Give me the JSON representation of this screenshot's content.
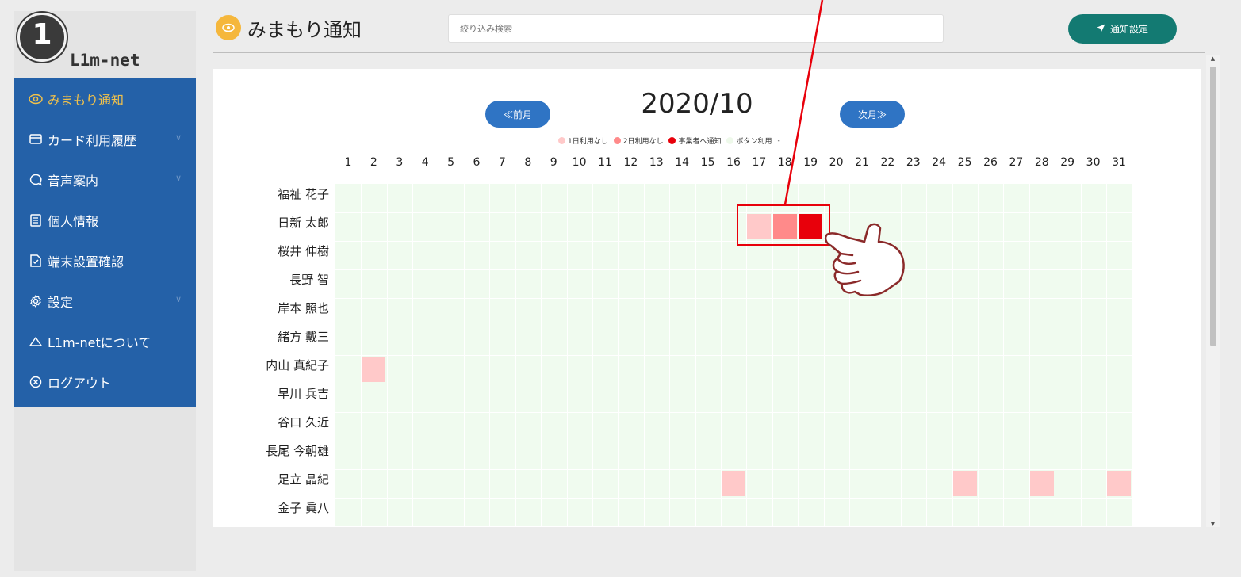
{
  "brand": {
    "logo_text": "L1m-net"
  },
  "sidebar": {
    "items": [
      {
        "label": "みまもり通知",
        "icon": "eye-icon"
      },
      {
        "label": "カード利用履歴",
        "icon": "card-icon"
      },
      {
        "label": "音声案内",
        "icon": "speech-bubble-icon"
      },
      {
        "label": "個人情報",
        "icon": "document-icon"
      },
      {
        "label": "端末設置確認",
        "icon": "check-document-icon"
      },
      {
        "label": "設定",
        "icon": "gear-icon"
      },
      {
        "label": "L1m-netについて",
        "icon": "cloud-icon"
      },
      {
        "label": "ログアウト",
        "icon": "close-circle-icon"
      }
    ],
    "active_index": 0
  },
  "header": {
    "title": "みまもり通知",
    "search_placeholder": "絞り込み検索",
    "notify_button": "通知設定"
  },
  "calendar": {
    "month": "2020/10",
    "prev_label": "≪前月",
    "next_label": "次月≫",
    "legend": [
      {
        "label": "1日利用なし",
        "color": "#ffc9c9"
      },
      {
        "label": "2日利用なし",
        "color": "#ff8a8a"
      },
      {
        "label": "事業者へ通知",
        "color": "#e8000b"
      },
      {
        "label": "ボタン利用",
        "color": "#eef9ea"
      },
      {
        "label": "-",
        "color": ""
      }
    ],
    "days": [
      "1",
      "2",
      "3",
      "4",
      "5",
      "6",
      "7",
      "8",
      "9",
      "10",
      "11",
      "12",
      "13",
      "14",
      "15",
      "16",
      "17",
      "18",
      "19",
      "20",
      "21",
      "22",
      "23",
      "24",
      "25",
      "26",
      "27",
      "28",
      "29",
      "30",
      "31"
    ],
    "rows": [
      {
        "name": "福祉 花子",
        "marks": []
      },
      {
        "name": "日新 太郎",
        "marks": [
          {
            "day": 17,
            "level": 1
          },
          {
            "day": 18,
            "level": 2
          },
          {
            "day": 19,
            "level": 3
          }
        ]
      },
      {
        "name": "桜井 伸樹",
        "marks": []
      },
      {
        "name": "長野 智",
        "marks": []
      },
      {
        "name": "岸本 照也",
        "marks": []
      },
      {
        "name": "緒方 戴三",
        "marks": []
      },
      {
        "name": "内山 真紀子",
        "marks": [
          {
            "day": 2,
            "level": 1
          }
        ]
      },
      {
        "name": "早川 兵吉",
        "marks": []
      },
      {
        "name": "谷口 久近",
        "marks": []
      },
      {
        "name": "長尾 今朝雄",
        "marks": []
      },
      {
        "name": "足立 晶紀",
        "marks": [
          {
            "day": 16,
            "level": 1
          },
          {
            "day": 25,
            "level": 1
          },
          {
            "day": 28,
            "level": 1
          },
          {
            "day": 31,
            "level": 1
          }
        ]
      },
      {
        "name": "金子 眞八",
        "marks": []
      }
    ],
    "level_colors": {
      "1": "#ffc9c9",
      "2": "#ff8a8a",
      "3": "#e8000b"
    }
  }
}
